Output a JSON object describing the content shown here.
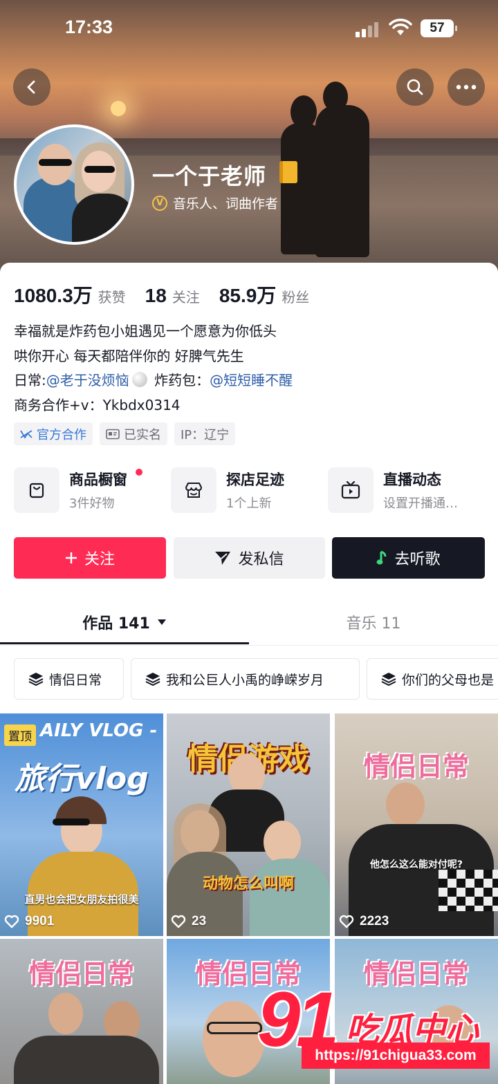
{
  "status_bar": {
    "time": "17:33",
    "battery": "57"
  },
  "profile": {
    "name": "一个于老师",
    "verification": "音乐人、词曲作者",
    "verify_badge": "V"
  },
  "stats": [
    {
      "value": "1080.3万",
      "label": "获赞"
    },
    {
      "value": "18",
      "label": "关注"
    },
    {
      "value": "85.9万",
      "label": "粉丝"
    }
  ],
  "bio": {
    "line1": "幸福就是炸药包小姐遇见一个愿意为你低头",
    "line2": "哄你开心 每天都陪伴你的 好脾气先生",
    "line3_prefix": "日常:",
    "line3_mention1": "@老于没烦恼",
    "line3_middle": " 炸药包：",
    "line3_mention2": "@短短睡不醒",
    "line4": "商务合作+v：Ykbdx0314"
  },
  "tags": [
    "官方合作",
    "已实名",
    "IP：辽宁"
  ],
  "features": [
    {
      "title": "商品橱窗",
      "subtitle": "3件好物"
    },
    {
      "title": "探店足迹",
      "subtitle": "1个上新"
    },
    {
      "title": "直播动态",
      "subtitle": "设置开播通…"
    }
  ],
  "actions": {
    "follow": "关注",
    "message": "发私信",
    "listen": "去听歌"
  },
  "tabs": [
    {
      "label": "作品 141"
    },
    {
      "label": "音乐 11"
    }
  ],
  "collections": [
    "情侣日常",
    "我和公巨人小禹的峥嵘岁月",
    "你们的父母也是"
  ],
  "videos": [
    {
      "pinned": "置顶",
      "header": "AILY VLOG -",
      "title": "旅行vlog",
      "caption": "直男也会把女朋友拍很美",
      "likes": "9901"
    },
    {
      "title": "情侣游戏",
      "caption": "动物怎么叫啊",
      "likes": "23"
    },
    {
      "title": "情侣日常",
      "caption": "他怎么这么能对付呢?",
      "likes": "2223"
    },
    {
      "title": "情侣日常",
      "caption": "",
      "likes": ""
    },
    {
      "title": "情侣日常",
      "caption": "",
      "likes": ""
    },
    {
      "title": "情侣日常",
      "caption": "",
      "likes": ""
    }
  ],
  "watermark": {
    "number": "91",
    "text": "吃瓜中心",
    "url": "https://91chigua33.com"
  },
  "colors": {
    "accent": "#fe2c55",
    "dark": "#161823",
    "link": "#2e5da8"
  }
}
